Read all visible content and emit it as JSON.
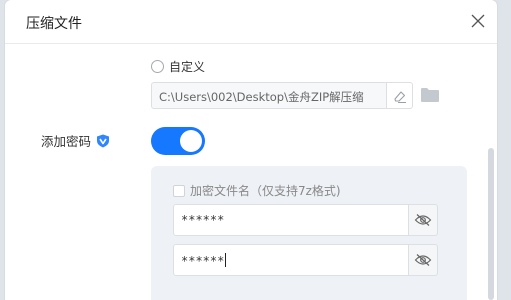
{
  "dialog": {
    "title": "压缩文件",
    "close_icon": "close-icon"
  },
  "save_location": {
    "custom_option_label": "自定义",
    "custom_selected": false,
    "path_value": "C:\\Users\\002\\Desktop\\金舟ZIP解压缩",
    "clear_icon": "eraser-icon",
    "browse_icon": "folder-icon"
  },
  "password": {
    "label": "添加密码",
    "badge_icon": "vip-shield-icon",
    "enabled": true,
    "encrypt_filenames_label": "加密文件名（仅支持7z格式)",
    "encrypt_filenames_checked": false,
    "password_value": "******",
    "confirm_value": "******",
    "visibility_icon": "eye-hidden-icon"
  },
  "colors": {
    "accent": "#1677ff",
    "panel_bg": "#eef1f6"
  }
}
